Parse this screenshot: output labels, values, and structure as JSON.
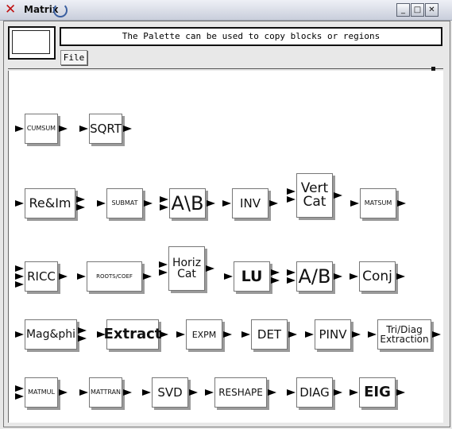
{
  "window": {
    "title": "Matrix",
    "close_glyph": "✕",
    "btn_min": "_",
    "btn_max": "□",
    "btn_close": "✕"
  },
  "message": "The Palette can be used to copy blocks or regions",
  "menu": {
    "file": "File"
  },
  "blocks": [
    {
      "label": "CUMSUM",
      "in": 1,
      "out": 1
    },
    {
      "label": "SQRT",
      "in": 1,
      "out": 1
    },
    {
      "label": "Re&Im",
      "in": 1,
      "out": 2
    },
    {
      "label": "SUBMAT",
      "in": 1,
      "out": 1
    },
    {
      "label": "A\\B",
      "in": 2,
      "out": 1
    },
    {
      "label": "INV",
      "in": 1,
      "out": 1
    },
    {
      "label": "Vert\nCat",
      "in": 2,
      "out": 1
    },
    {
      "label": "MATSUM",
      "in": 1,
      "out": 1
    },
    {
      "label": "RICC",
      "in": 3,
      "out": 1
    },
    {
      "label": "ROOTS/COEF",
      "in": 1,
      "out": 1
    },
    {
      "label": "Horiz\nCat",
      "in": 2,
      "out": 1
    },
    {
      "label": "LU",
      "in": 1,
      "out": 2
    },
    {
      "label": "A/B",
      "in": 2,
      "out": 1
    },
    {
      "label": "Conj",
      "in": 1,
      "out": 1
    },
    {
      "label": "Mag&phi",
      "in": 1,
      "out": 2
    },
    {
      "label": "Extract",
      "in": 1,
      "out": 1
    },
    {
      "label": "EXPM",
      "in": 1,
      "out": 1
    },
    {
      "label": "DET",
      "in": 1,
      "out": 1
    },
    {
      "label": "PINV",
      "in": 1,
      "out": 1
    },
    {
      "label": "Tri/Diag\nExtraction",
      "in": 1,
      "out": 1
    },
    {
      "label": "MATMUL",
      "in": 2,
      "out": 1
    },
    {
      "label": "MATTRAN",
      "in": 1,
      "out": 1
    },
    {
      "label": "SVD",
      "in": 1,
      "out": 1
    },
    {
      "label": "RESHAPE",
      "in": 1,
      "out": 1
    },
    {
      "label": "DIAG",
      "in": 1,
      "out": 1
    },
    {
      "label": "EIG",
      "in": 1,
      "out": 1
    }
  ]
}
